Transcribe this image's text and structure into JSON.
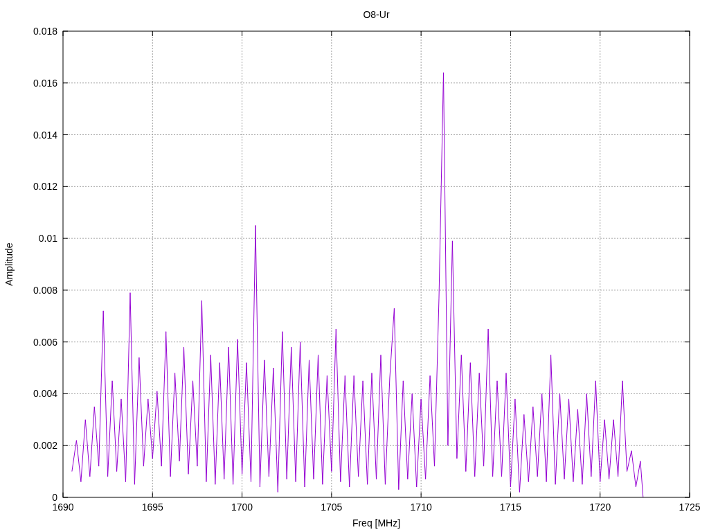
{
  "chart_data": {
    "type": "line",
    "grid": true,
    "title": "O8-Ur",
    "xlabel": "Freq [MHz]",
    "ylabel": "Amplitude",
    "xlim": [
      1690,
      1725
    ],
    "ylim": [
      0,
      0.018
    ],
    "xticks": [
      1690,
      1695,
      1700,
      1705,
      1710,
      1715,
      1720,
      1725
    ],
    "yticks": [
      {
        "value": 0,
        "label": "0"
      },
      {
        "value": 0.002,
        "label": "0.002"
      },
      {
        "value": 0.004,
        "label": "0.004"
      },
      {
        "value": 0.006,
        "label": "0.006"
      },
      {
        "value": 0.008,
        "label": "0.008"
      },
      {
        "value": 0.01,
        "label": "0.01"
      },
      {
        "value": 0.012,
        "label": "0.012"
      },
      {
        "value": 0.014,
        "label": "0.014"
      },
      {
        "value": 0.016,
        "label": "0.016"
      },
      {
        "value": 0.018,
        "label": "0.018"
      }
    ],
    "x": [
      1690.5,
      1690.75,
      1691,
      1691.25,
      1691.5,
      1691.75,
      1692,
      1692.25,
      1692.5,
      1692.75,
      1693,
      1693.25,
      1693.5,
      1693.75,
      1694,
      1694.25,
      1694.5,
      1694.75,
      1695,
      1695.25,
      1695.5,
      1695.75,
      1696,
      1696.25,
      1696.5,
      1696.75,
      1697,
      1697.25,
      1697.5,
      1697.75,
      1698,
      1698.25,
      1698.5,
      1698.75,
      1699,
      1699.25,
      1699.5,
      1699.75,
      1700,
      1700.25,
      1700.5,
      1700.75,
      1701,
      1701.25,
      1701.5,
      1701.75,
      1702,
      1702.25,
      1702.5,
      1702.75,
      1703,
      1703.25,
      1703.5,
      1703.75,
      1704,
      1704.25,
      1704.5,
      1704.75,
      1705,
      1705.25,
      1705.5,
      1705.75,
      1706,
      1706.25,
      1706.5,
      1706.75,
      1707,
      1707.25,
      1707.5,
      1707.75,
      1708,
      1708.25,
      1708.5,
      1708.75,
      1709,
      1709.25,
      1709.5,
      1709.75,
      1710,
      1710.25,
      1710.5,
      1710.75,
      1711,
      1711.25,
      1711.5,
      1711.75,
      1712,
      1712.25,
      1712.5,
      1712.75,
      1713,
      1713.25,
      1713.5,
      1713.75,
      1714,
      1714.25,
      1714.5,
      1714.75,
      1715,
      1715.25,
      1715.5,
      1715.75,
      1716,
      1716.25,
      1716.5,
      1716.75,
      1717,
      1717.25,
      1717.5,
      1717.75,
      1718,
      1718.25,
      1718.5,
      1718.75,
      1719,
      1719.25,
      1719.5,
      1719.75,
      1720,
      1720.25,
      1720.5,
      1720.75,
      1721,
      1721.25,
      1721.5,
      1721.75,
      1722,
      1722.25,
      1722.4
    ],
    "series": [
      {
        "color": "#9400d3",
        "values": [
          0.001,
          0.0022,
          0.0006,
          0.003,
          0.0008,
          0.0035,
          0.0012,
          0.0072,
          0.0008,
          0.0045,
          0.001,
          0.0038,
          0.0006,
          0.0079,
          0.0005,
          0.0054,
          0.0012,
          0.0038,
          0.0015,
          0.0041,
          0.0012,
          0.0064,
          0.0008,
          0.0048,
          0.0014,
          0.0058,
          0.0009,
          0.0045,
          0.0012,
          0.0076,
          0.0006,
          0.0055,
          0.0005,
          0.0052,
          0.0007,
          0.0058,
          0.0005,
          0.0061,
          0.0009,
          0.0052,
          0.0006,
          0.0105,
          0.0004,
          0.0053,
          0.0008,
          0.005,
          0.0002,
          0.0064,
          0.0007,
          0.0058,
          0.0006,
          0.006,
          0.0004,
          0.0053,
          0.0007,
          0.0055,
          0.0005,
          0.0047,
          0.001,
          0.0065,
          0.0006,
          0.0047,
          0.0004,
          0.0047,
          0.0008,
          0.0045,
          0.0005,
          0.0048,
          0.0007,
          0.0055,
          0.0005,
          0.0046,
          0.0073,
          0.0003,
          0.0045,
          0.0007,
          0.004,
          0.0004,
          0.0038,
          0.0007,
          0.0047,
          0.0012,
          0.0077,
          0.0164,
          0.002,
          0.0099,
          0.0015,
          0.0055,
          0.001,
          0.0052,
          0.0008,
          0.0048,
          0.0012,
          0.0065,
          0.0008,
          0.0045,
          0.0008,
          0.0048,
          0.0004,
          0.0038,
          0.0002,
          0.0032,
          0.0006,
          0.0035,
          0.0008,
          0.004,
          0.0006,
          0.0055,
          0.0005,
          0.004,
          0.0007,
          0.0038,
          0.0006,
          0.0034,
          0.0005,
          0.004,
          0.0008,
          0.0045,
          0.0006,
          0.003,
          0.0007,
          0.003,
          0.0008,
          0.0045,
          0.001,
          0.0018,
          0.0004,
          0.0014,
          0
        ]
      }
    ]
  }
}
